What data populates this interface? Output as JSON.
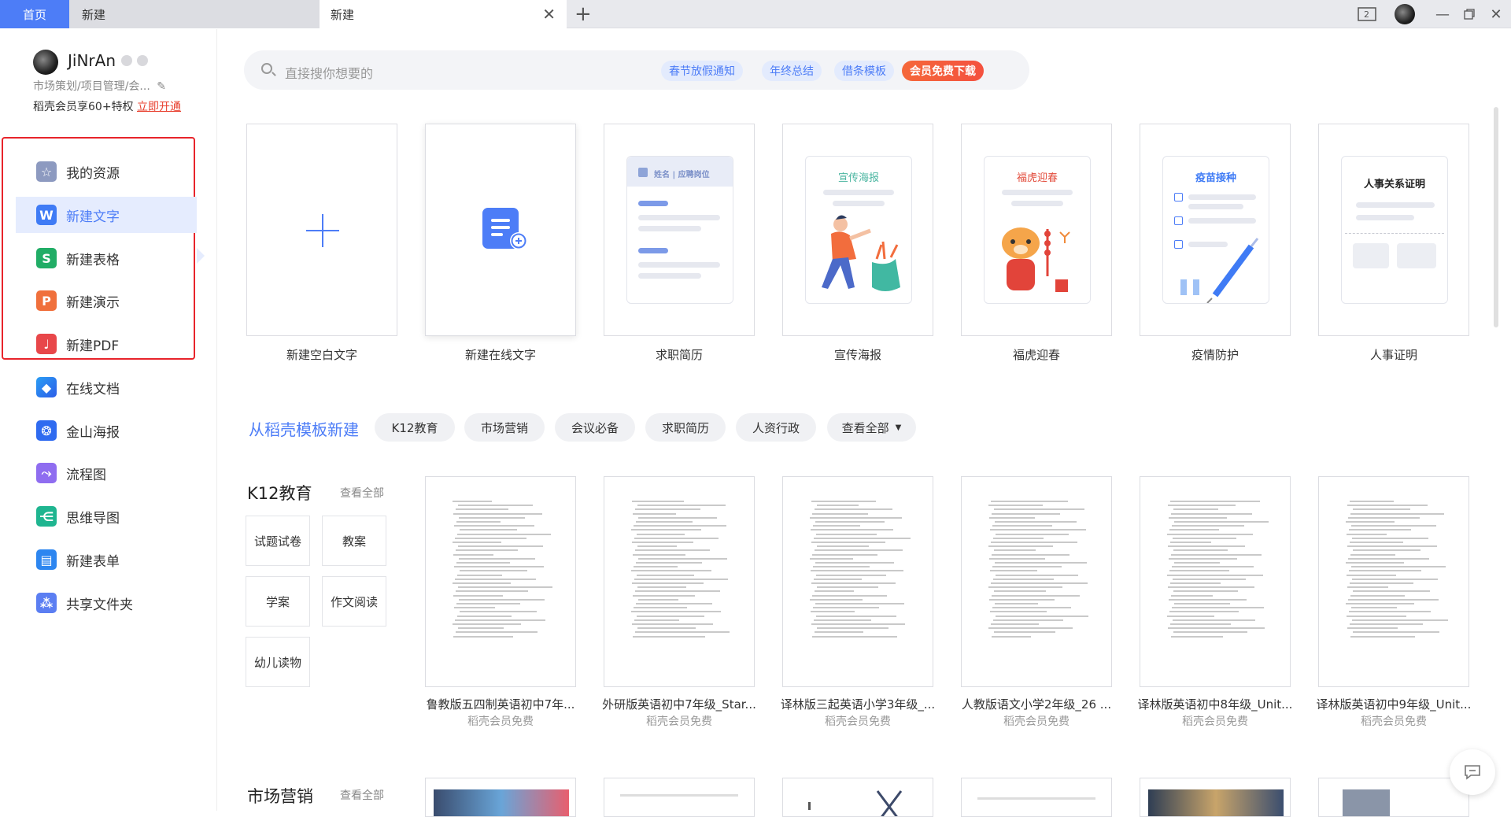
{
  "tabs": {
    "home": "首页",
    "tab1": "新建",
    "tab2": "新建",
    "tab_count": "2"
  },
  "user": {
    "name": "JiNrAn",
    "role": "市场策划/项目管理/会...",
    "vip_text": "稻壳会员享60+特权",
    "vip_link": "立即开通"
  },
  "sidebar": {
    "items": [
      {
        "label": "我的资源",
        "icon": "star-icon"
      },
      {
        "label": "新建文字",
        "icon": "writer-w-icon"
      },
      {
        "label": "新建表格",
        "icon": "sheet-s-icon"
      },
      {
        "label": "新建演示",
        "icon": "presentation-p-icon"
      },
      {
        "label": "新建PDF",
        "icon": "pdf-icon"
      },
      {
        "label": "在线文档",
        "icon": "cloud-doc-icon"
      },
      {
        "label": "金山海报",
        "icon": "poster-icon"
      },
      {
        "label": "流程图",
        "icon": "flowchart-icon"
      },
      {
        "label": "思维导图",
        "icon": "mindmap-icon"
      },
      {
        "label": "新建表单",
        "icon": "form-icon"
      },
      {
        "label": "共享文件夹",
        "icon": "shared-folder-icon"
      }
    ]
  },
  "search": {
    "placeholder": "直接搜你想要的",
    "chips": [
      "春节放假通知",
      "年终总结",
      "借条模板"
    ],
    "vip_chip": "会员免费下载"
  },
  "new_cards": [
    {
      "label": "新建空白文字"
    },
    {
      "label": "新建在线文字"
    },
    {
      "label": "求职简历",
      "inner_title": "姓名 | 应聘岗位"
    },
    {
      "label": "宣传海报",
      "inner_title": "宣传海报"
    },
    {
      "label": "福虎迎春",
      "inner_title": "福虎迎春"
    },
    {
      "label": "疫情防护",
      "inner_title": "疫苗接种"
    },
    {
      "label": "人事证明",
      "inner_title": "人事关系证明"
    }
  ],
  "template_section": {
    "title": "从稻壳模板新建",
    "pills": [
      "K12教育",
      "市场营销",
      "会议必备",
      "求职简历",
      "人资行政"
    ],
    "see_all": "查看全部"
  },
  "k12": {
    "title": "K12教育",
    "see_all": "查看全部",
    "buttons": [
      "试题试卷",
      "教案",
      "学案",
      "作文阅读",
      "幼儿读物"
    ],
    "docs": [
      {
        "title": "鲁教版五四制英语初中7年...",
        "sub": "稻壳会员免费"
      },
      {
        "title": "外研版英语初中7年级_Star...",
        "sub": "稻壳会员免费"
      },
      {
        "title": "译林版三起英语小学3年级_...",
        "sub": "稻壳会员免费"
      },
      {
        "title": "人教版语文小学2年级_26 ...",
        "sub": "稻壳会员免费"
      },
      {
        "title": "译林版英语初中8年级_Unit...",
        "sub": "稻壳会员免费"
      },
      {
        "title": "译林版英语初中9年级_Unit...",
        "sub": "稻壳会员免费"
      }
    ]
  },
  "market": {
    "title": "市场营销",
    "see_all": "查看全部"
  },
  "colors": {
    "accent": "#4d7df7",
    "red": "#e8242b",
    "vip": "#f4513f"
  }
}
